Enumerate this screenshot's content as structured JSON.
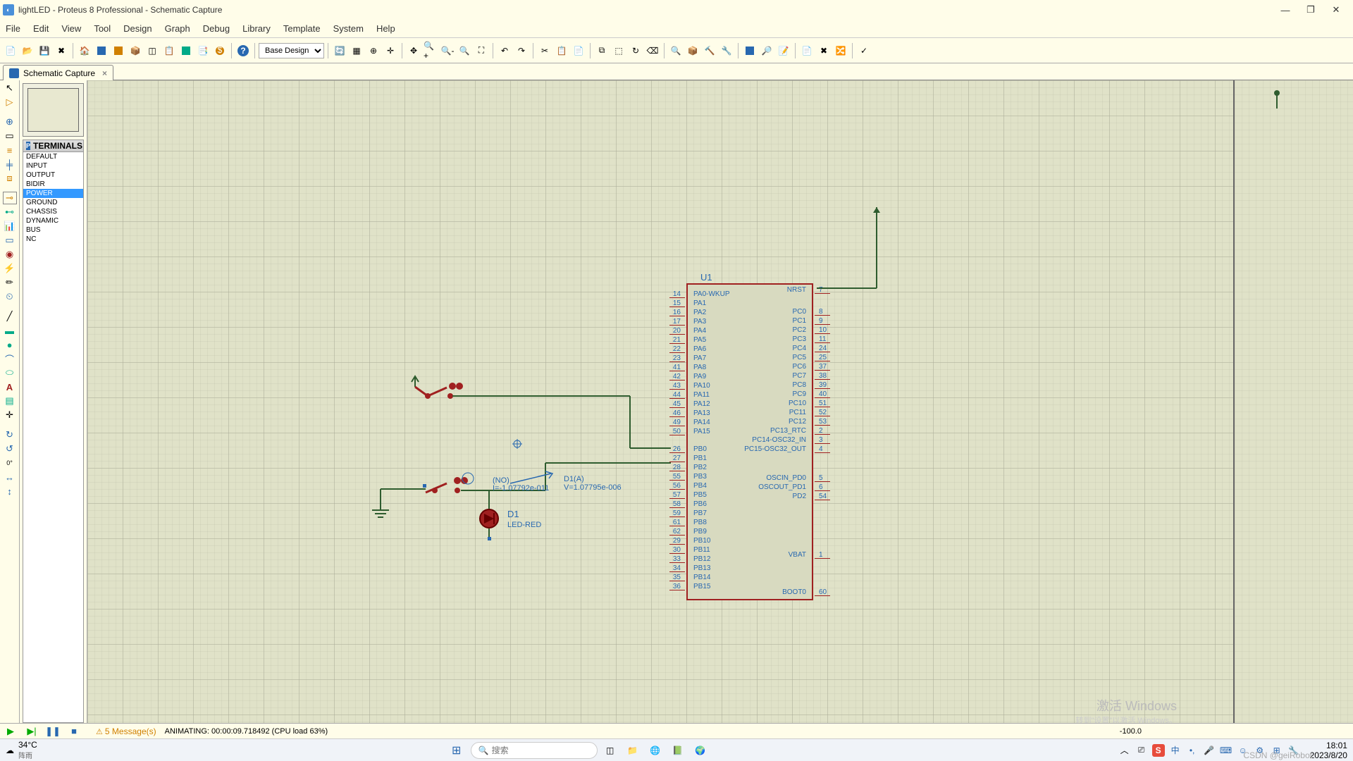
{
  "title": "lightLED - Proteus 8 Professional - Schematic Capture",
  "menu": [
    "File",
    "Edit",
    "View",
    "Tool",
    "Design",
    "Graph",
    "Debug",
    "Library",
    "Template",
    "System",
    "Help"
  ],
  "design_select": "Base Design",
  "tab": {
    "label": "Schematic Capture"
  },
  "terminals": {
    "header": "TERMINALS",
    "items": [
      "DEFAULT",
      "INPUT",
      "OUTPUT",
      "BIDIR",
      "POWER",
      "GROUND",
      "CHASSIS",
      "DYNAMIC",
      "BUS",
      "NC"
    ],
    "selected": "POWER"
  },
  "chip": {
    "ref": "U1",
    "left_pins": [
      {
        "num": "14",
        "name": "PA0-WKUP"
      },
      {
        "num": "15",
        "name": "PA1"
      },
      {
        "num": "16",
        "name": "PA2"
      },
      {
        "num": "17",
        "name": "PA3"
      },
      {
        "num": "20",
        "name": "PA4"
      },
      {
        "num": "21",
        "name": "PA5"
      },
      {
        "num": "22",
        "name": "PA6"
      },
      {
        "num": "23",
        "name": "PA7"
      },
      {
        "num": "41",
        "name": "PA8"
      },
      {
        "num": "42",
        "name": "PA9"
      },
      {
        "num": "43",
        "name": "PA10"
      },
      {
        "num": "44",
        "name": "PA11"
      },
      {
        "num": "45",
        "name": "PA12"
      },
      {
        "num": "46",
        "name": "PA13"
      },
      {
        "num": "49",
        "name": "PA14"
      },
      {
        "num": "50",
        "name": "PA15"
      },
      {
        "num": "26",
        "name": "PB0"
      },
      {
        "num": "27",
        "name": "PB1"
      },
      {
        "num": "28",
        "name": "PB2"
      },
      {
        "num": "55",
        "name": "PB3"
      },
      {
        "num": "56",
        "name": "PB4"
      },
      {
        "num": "57",
        "name": "PB5"
      },
      {
        "num": "58",
        "name": "PB6"
      },
      {
        "num": "59",
        "name": "PB7"
      },
      {
        "num": "61",
        "name": "PB8"
      },
      {
        "num": "62",
        "name": "PB9"
      },
      {
        "num": "29",
        "name": "PB10"
      },
      {
        "num": "30",
        "name": "PB11"
      },
      {
        "num": "33",
        "name": "PB12"
      },
      {
        "num": "34",
        "name": "PB13"
      },
      {
        "num": "35",
        "name": "PB14"
      },
      {
        "num": "36",
        "name": "PB15"
      }
    ],
    "right_pins": [
      {
        "num": "7",
        "name": "NRST"
      },
      {
        "num": "8",
        "name": "PC0"
      },
      {
        "num": "9",
        "name": "PC1"
      },
      {
        "num": "10",
        "name": "PC2"
      },
      {
        "num": "11",
        "name": "PC3"
      },
      {
        "num": "24",
        "name": "PC4"
      },
      {
        "num": "25",
        "name": "PC5"
      },
      {
        "num": "37",
        "name": "PC6"
      },
      {
        "num": "38",
        "name": "PC7"
      },
      {
        "num": "39",
        "name": "PC8"
      },
      {
        "num": "40",
        "name": "PC9"
      },
      {
        "num": "51",
        "name": "PC10"
      },
      {
        "num": "52",
        "name": "PC11"
      },
      {
        "num": "53",
        "name": "PC12"
      },
      {
        "num": "2",
        "name": "PC13_RTC"
      },
      {
        "num": "3",
        "name": "PC14-OSC32_IN"
      },
      {
        "num": "4",
        "name": "PC15-OSC32_OUT"
      },
      {
        "num": "5",
        "name": "OSCIN_PD0"
      },
      {
        "num": "6",
        "name": "OSCOUT_PD1"
      },
      {
        "num": "54",
        "name": "PD2"
      },
      {
        "num": "1",
        "name": "VBAT"
      },
      {
        "num": "60",
        "name": "BOOT0"
      }
    ]
  },
  "probe1": {
    "name": "(NO)",
    "value": "I=-1.07792e-011"
  },
  "probe2": {
    "name": "D1(A)",
    "value": "V=1.07795e-006"
  },
  "led": {
    "ref": "D1",
    "part": "LED-RED"
  },
  "status": {
    "messages": "5 Message(s)",
    "anim": "ANIMATING: 00:00:09.718492 (CPU load 63%)",
    "coord": "-100.0"
  },
  "watermark": {
    "line1": "激活 Windows",
    "line2": "转到\"设置\"以激活 Windows。"
  },
  "weather": {
    "temp": "34°C",
    "desc": "阵雨"
  },
  "search_placeholder": "搜索",
  "clock": {
    "time": "18:01",
    "date": "2023/8/20"
  },
  "csdn": "CSDN @geiRobot"
}
